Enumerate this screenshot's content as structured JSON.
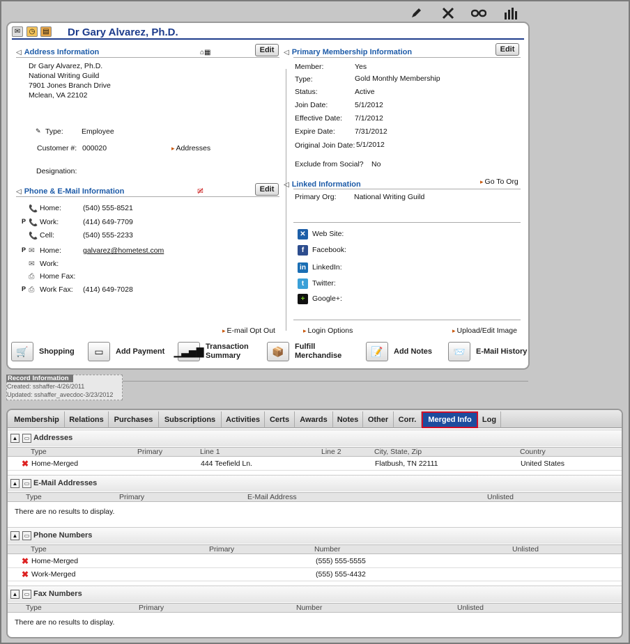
{
  "toolbar": {
    "icons": [
      "pencil-icon",
      "tools-icon",
      "link-icon",
      "chart-icon"
    ]
  },
  "profile": {
    "name": "Dr Gary Alvarez, Ph.D."
  },
  "address": {
    "title": "Address Information",
    "edit": "Edit",
    "lines": [
      "Dr Gary Alvarez, Ph.D.",
      "National Writing Guild",
      "7901 Jones Branch Drive",
      "Mclean, VA 22102"
    ],
    "type_label": "Type:",
    "type_value": "Employee",
    "customer_label": "Customer #:",
    "customer_value": "000020",
    "addresses_link": "Addresses",
    "designation_label": "Designation:"
  },
  "phone": {
    "title": "Phone & E-Mail Information",
    "edit": "Edit",
    "rows": [
      {
        "flag": "",
        "label": "Home:",
        "value": "(540) 555-8521"
      },
      {
        "flag": "P",
        "label": "Work:",
        "value": "(414) 649-7709"
      },
      {
        "flag": "",
        "label": "Cell:",
        "value": "(540) 555-2233"
      },
      {
        "flag": "P",
        "label": "Home:",
        "value": "galvarez@hometest.com"
      },
      {
        "flag": "",
        "label": "Work:",
        "value": ""
      },
      {
        "flag": "",
        "label": "Home Fax:",
        "value": ""
      },
      {
        "flag": "P",
        "label": "Work Fax:",
        "value": "(414) 649-7028"
      }
    ],
    "optout": "E-mail Opt Out"
  },
  "membership": {
    "title": "Primary Membership Information",
    "edit": "Edit",
    "rows": [
      {
        "label": "Member:",
        "value": "Yes"
      },
      {
        "label": "Type:",
        "value": "Gold Monthly Membership"
      },
      {
        "label": "Status:",
        "value": "Active"
      },
      {
        "label": "Join Date:",
        "value": "5/1/2012"
      },
      {
        "label": "Effective Date:",
        "value": "7/1/2012"
      },
      {
        "label": "Expire Date:",
        "value": "7/31/2012"
      },
      {
        "label": "Original Join Date:",
        "value": "5/1/2012"
      }
    ],
    "social_label": "Exclude from Social?",
    "social_value": "No"
  },
  "linked": {
    "title": "Linked Information",
    "goto": "Go To Org",
    "org_label": "Primary Org:",
    "org_value": "National Writing Guild",
    "socials": [
      "Web Site:",
      "Facebook:",
      "LinkedIn:",
      "Twitter:",
      "Google+:"
    ],
    "login": "Login Options",
    "upload": "Upload/Edit Image"
  },
  "actions": [
    {
      "label": "Shopping",
      "label2": ""
    },
    {
      "label": "Add Payment",
      "label2": ""
    },
    {
      "label": "Transaction",
      "label2": "Summary"
    },
    {
      "label": "Fulfill",
      "label2": "Merchandise"
    },
    {
      "label": "Add Notes",
      "label2": ""
    },
    {
      "label": "E-Mail History",
      "label2": ""
    }
  ],
  "record": {
    "title": "Record Information",
    "created": "Created: sshaffer-4/26/2011",
    "updated": "Updated: sshaffer_avecdoc-3/23/2012"
  },
  "tabs": [
    "Membership",
    "Relations",
    "Purchases",
    "Subscriptions",
    "Activities",
    "Certs",
    "Awards",
    "Notes",
    "Other",
    "Corr.",
    "Merged Info",
    "Log"
  ],
  "active_tab": "Merged Info",
  "merged": {
    "addresses": {
      "title": "Addresses",
      "cols": [
        "Type",
        "Primary",
        "Line 1",
        "Line 2",
        "City, State, Zip",
        "Country"
      ],
      "rows": [
        {
          "type": "Home-Merged",
          "line1": "444 Teefield Ln.",
          "city": "Flatbush, TN 22111",
          "country": "United States"
        }
      ]
    },
    "emails": {
      "title": "E-Mail Addresses",
      "cols": [
        "Type",
        "Primary",
        "E-Mail Address",
        "Unlisted"
      ],
      "empty": "There are no results to display."
    },
    "phones": {
      "title": "Phone Numbers",
      "cols": [
        "Type",
        "Primary",
        "Number",
        "Unlisted"
      ],
      "rows": [
        {
          "type": "Home-Merged",
          "number": "(555) 555-5555"
        },
        {
          "type": "Work-Merged",
          "number": "(555) 555-4432"
        }
      ]
    },
    "fax": {
      "title": "Fax Numbers",
      "cols": [
        "Type",
        "Primary",
        "Number",
        "Unlisted"
      ],
      "empty": "There are no results to display."
    }
  }
}
